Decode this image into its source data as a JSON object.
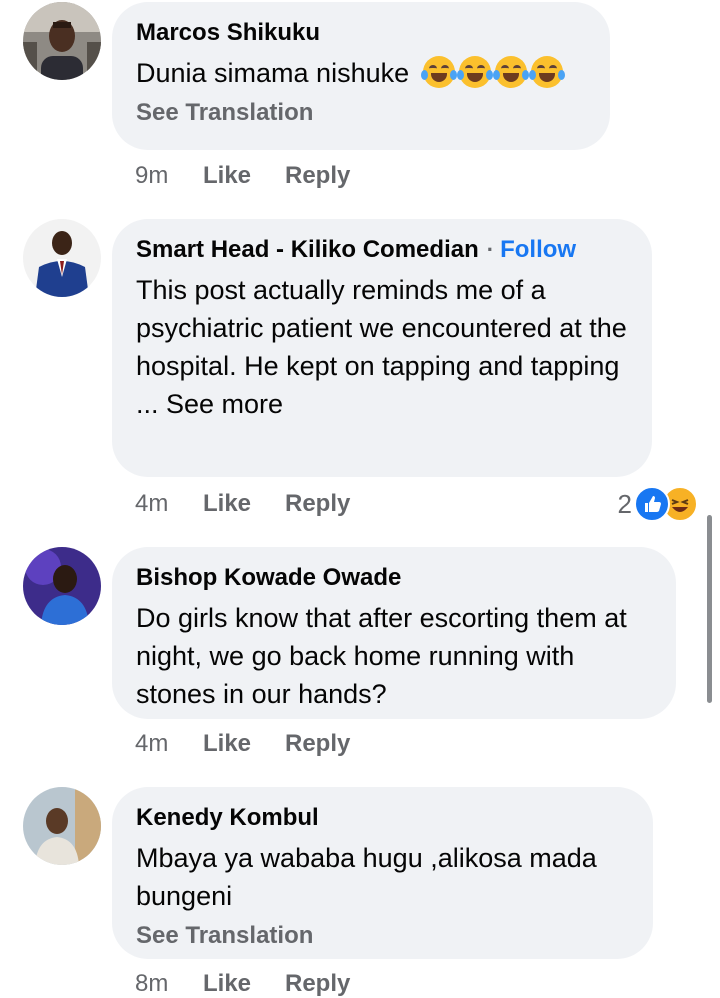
{
  "comments": [
    {
      "author": "Marcos Shikuku",
      "text": "Dunia simama nishuke",
      "emoji": "face-with-tears-of-joy",
      "emoji_count": 4,
      "see_translation": "See Translation",
      "time": "9m",
      "like": "Like",
      "reply": "Reply"
    },
    {
      "author": "Smart Head - Kiliko Comedian",
      "separator": "·",
      "follow": "Follow",
      "text": "This post actually reminds me of a psychiatric patient we encountered at the hospital. He kept on tapping and tapping",
      "see_more": "... See more",
      "time": "4m",
      "like": "Like",
      "reply": "Reply",
      "reaction_count": "2",
      "reactions": [
        "like-reaction-icon",
        "haha-reaction-icon"
      ]
    },
    {
      "author": "Bishop Kowade Owade",
      "text": "Do girls know that after escorting them at night, we go back home running with stones in our hands?",
      "time": "4m",
      "like": "Like",
      "reply": "Reply"
    },
    {
      "author": "Kenedy Kombul",
      "text": "Mbaya ya wababa hugu ,alikosa mada bungeni",
      "see_translation": "See Translation",
      "time": "8m",
      "like": "Like",
      "reply": "Reply"
    }
  ],
  "colors": {
    "bubble": "#f0f2f5",
    "meta_text": "#65676b",
    "link": "#1877f2"
  }
}
